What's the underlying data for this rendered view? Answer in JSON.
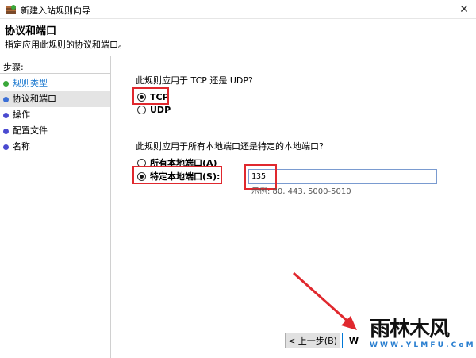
{
  "window": {
    "title": "新建入站规则向导",
    "close_glyph": "✕"
  },
  "header": {
    "title": "协议和端口",
    "description": "指定应用此规则的协议和端口。"
  },
  "sidebar": {
    "label": "步骤:",
    "items": [
      {
        "label": "规则类型",
        "state": "done"
      },
      {
        "label": "协议和端口",
        "state": "active"
      },
      {
        "label": "操作",
        "state": "pending"
      },
      {
        "label": "配置文件",
        "state": "pending"
      },
      {
        "label": "名称",
        "state": "pending"
      }
    ]
  },
  "protocol": {
    "question": "此规则应用于 TCP 还是 UDP?",
    "options": [
      {
        "label": "TCP",
        "checked": true
      },
      {
        "label": "UDP",
        "checked": false
      }
    ]
  },
  "ports": {
    "question": "此规则应用于所有本地端口还是特定的本地端口?",
    "options": [
      {
        "label": "所有本地端口(A)",
        "checked": false
      },
      {
        "label": "特定本地端口(S):",
        "checked": true
      }
    ],
    "value": "135",
    "example": "示例: 80, 443, 5000-5010"
  },
  "buttons": {
    "back": "< 上一步(B)",
    "next": "W"
  },
  "watermark": {
    "logo": "雨林木风",
    "url": "W W W . Y L M F U . C o M"
  },
  "colors": {
    "highlight": "#e0282e",
    "done_step": "#1f7bd0"
  }
}
